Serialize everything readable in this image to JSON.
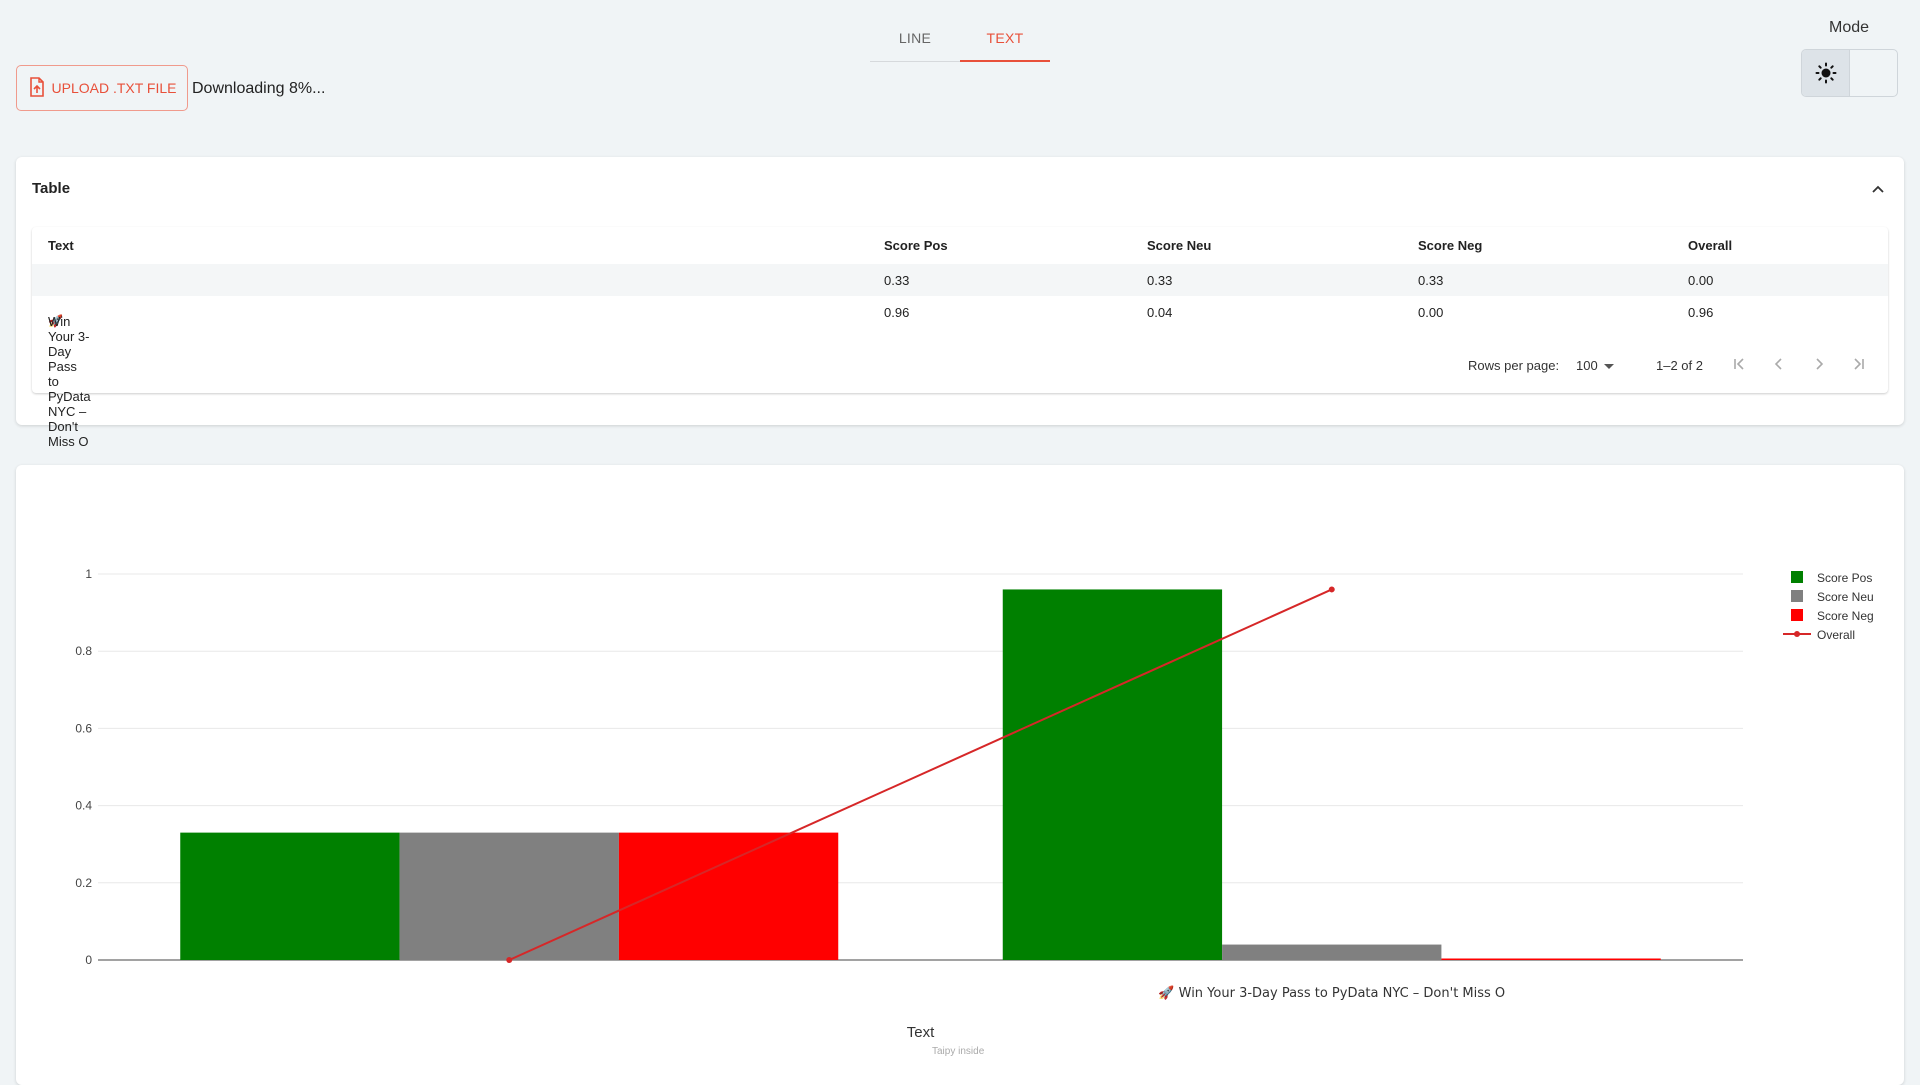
{
  "tabs": [
    {
      "label": "LINE",
      "active": false
    },
    {
      "label": "TEXT",
      "active": true
    }
  ],
  "upload": {
    "label": "UPLOAD .TXT FILE",
    "icon": "file-upload-icon"
  },
  "download_status": "Downloading 8%...",
  "mode": {
    "label": "Mode",
    "options": [
      "light",
      "dark"
    ],
    "selected": "light"
  },
  "table": {
    "title": "Table",
    "columns": [
      "Text",
      "Score Pos",
      "Score Neu",
      "Score Neg",
      "Overall"
    ],
    "rows": [
      {
        "text": "",
        "pos": "0.33",
        "neu": "0.33",
        "neg": "0.33",
        "overall": "0.00"
      },
      {
        "text": "Win Your 3-Day Pass to PyData NYC – Don't Miss O",
        "pos": "0.96",
        "neu": "0.04",
        "neg": "0.00",
        "overall": "0.96"
      }
    ],
    "pagination": {
      "rows_per_page_label": "Rows per page:",
      "rows_per_page": "100",
      "range": "1–2 of 2"
    }
  },
  "chart_data": {
    "type": "bar",
    "categories": [
      "",
      "Win Your 3-Day Pass to PyData NYC – Don't Miss O"
    ],
    "series": [
      {
        "name": "Score Pos",
        "type": "bar",
        "color": "#008000",
        "values": [
          0.33,
          0.96
        ]
      },
      {
        "name": "Score Neu",
        "type": "bar",
        "color": "#808080",
        "values": [
          0.33,
          0.04
        ]
      },
      {
        "name": "Score Neg",
        "type": "bar",
        "color": "#ff0000",
        "values": [
          0.33,
          0.0
        ]
      },
      {
        "name": "Overall",
        "type": "line",
        "color": "#d62728",
        "values": [
          0.0,
          0.96
        ]
      }
    ],
    "xlabel": "Text",
    "ylabel": "",
    "ylim": [
      0,
      1
    ],
    "yticks": [
      "0",
      "0.2",
      "0.4",
      "0.6",
      "0.8",
      "1"
    ],
    "legend": "top-right",
    "grid": true
  },
  "footer_note": "Taipy inside"
}
